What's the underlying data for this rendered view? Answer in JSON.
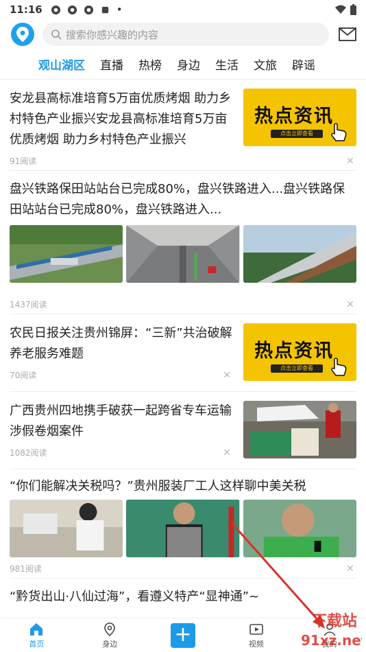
{
  "status_bar": {
    "time": "11:16",
    "dot": "•"
  },
  "search": {
    "placeholder": "搜索你感兴趣的内容"
  },
  "tabs": [
    {
      "label": "观山湖区",
      "active": true
    },
    {
      "label": "直播"
    },
    {
      "label": "热榜"
    },
    {
      "label": "身边"
    },
    {
      "label": "生活"
    },
    {
      "label": "文旅"
    },
    {
      "label": "辟谣"
    }
  ],
  "hot_banner": {
    "big": "热点资讯",
    "small": "点击立即查看"
  },
  "feed": [
    {
      "title": "安龙县高标准培育5万亩优质烤烟 助力乡村特色产业振兴安龙县高标准培育5万亩优质烤烟 助力乡村特色产业振兴",
      "reads": "91阅读"
    },
    {
      "title": "盘兴铁路保田站站台已完成80%，盘兴铁路进入...盘兴铁路保田站站台已完成80%，盘兴铁路进入...",
      "reads": "1437阅读"
    },
    {
      "title": "农民日报关注贵州锦屏：“三新”共治破解养老服务难题",
      "reads": "70阅读"
    },
    {
      "title": "广西贵州四地携手破获一起跨省专车运输涉假卷烟案件",
      "reads": "1082阅读"
    },
    {
      "title": "“你们能解决关税吗？”贵州服装厂工人这样聊中美关税",
      "reads": "981阅读"
    },
    {
      "title": "“黔货出山·八仙过海”，看遵义特产“显神通”~"
    }
  ],
  "bottom_nav": [
    {
      "label": "首页",
      "active": true
    },
    {
      "label": "身边"
    },
    {
      "label": ""
    },
    {
      "label": "视频"
    },
    {
      "label": "我的"
    }
  ],
  "watermark": {
    "line1": "下载站",
    "line2": "91xz.net"
  },
  "colors": {
    "accent": "#1e9be8",
    "hot_yellow": "#f5c400",
    "arrow_red": "#d9312a"
  }
}
